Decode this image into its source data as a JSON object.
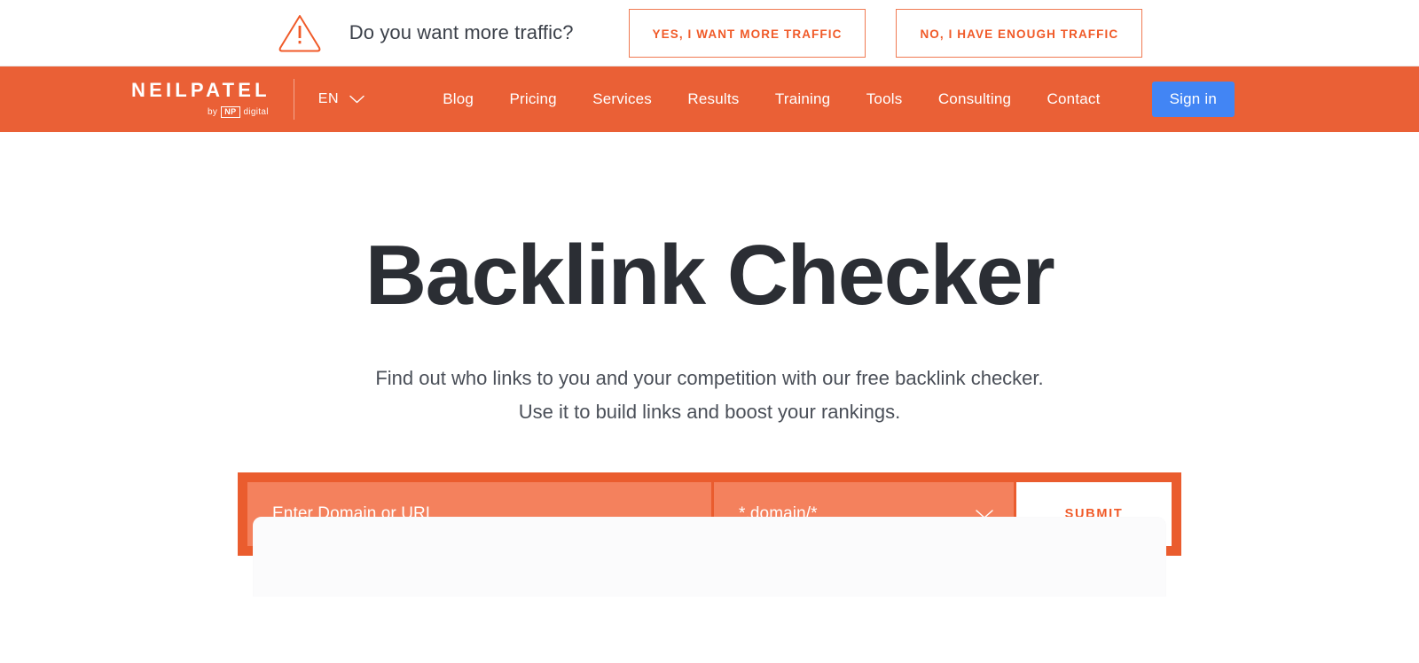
{
  "promo_banner": {
    "icon": "warning-triangle-icon",
    "question": "Do you want more traffic?",
    "yes_label": "YES, I WANT MORE TRAFFIC",
    "no_label": "NO, I HAVE ENOUGH TRAFFIC",
    "accent_color": "#f05a28",
    "text_color": "#3b4049"
  },
  "navbar": {
    "background_color": "#ea6036",
    "brand": {
      "name": "NEILPATEL",
      "by": "by",
      "np": "NP",
      "digital": "digital"
    },
    "language": {
      "label": "EN",
      "icon": "chevron-down-icon"
    },
    "links": [
      {
        "label": "Blog"
      },
      {
        "label": "Pricing"
      },
      {
        "label": "Services"
      },
      {
        "label": "Results"
      },
      {
        "label": "Training"
      },
      {
        "label": "Tools"
      },
      {
        "label": "Consulting"
      },
      {
        "label": "Contact"
      }
    ],
    "signin_label": "Sign in",
    "signin_color": "#4285f4"
  },
  "hero": {
    "title": "Backlink Checker",
    "title_color": "#2b2e34",
    "subtitle_line1": "Find out who links to you and your competition with our free backlink checker.",
    "subtitle_line2": "Use it to build links and boost your rankings."
  },
  "search": {
    "frame_color": "#ea5c2e",
    "field_color": "#f4815d",
    "domain_placeholder": "Enter Domain or URL",
    "domain_value": "",
    "scope_selected": "*.domain/*",
    "scope_icon": "chevron-down-icon",
    "submit_label": "SUBMIT"
  }
}
